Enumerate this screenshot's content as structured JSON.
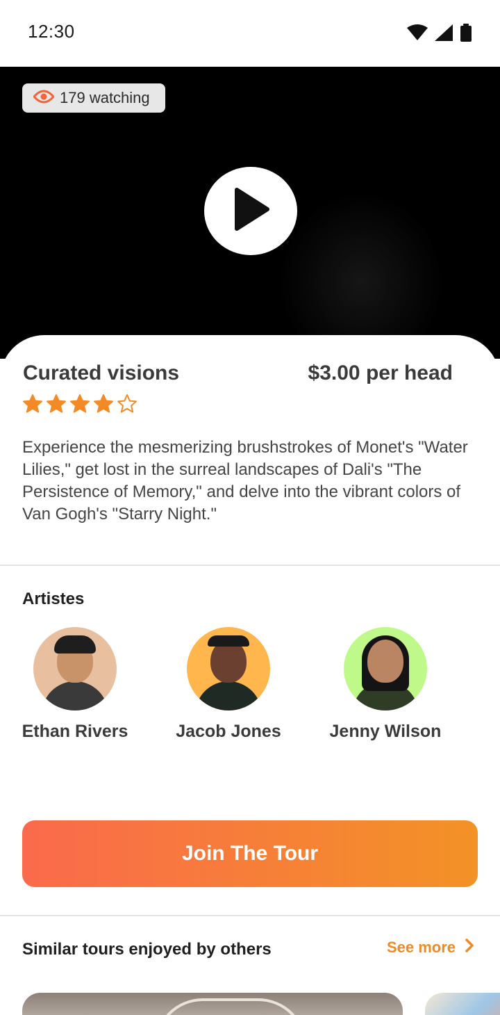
{
  "status_bar": {
    "time": "12:30",
    "icons": [
      "wifi-icon",
      "signal-icon",
      "battery-icon"
    ]
  },
  "video": {
    "watching_count": "179 watching",
    "icons": [
      "eye-icon",
      "play-icon"
    ]
  },
  "tour": {
    "title": "Curated visions",
    "price": "$3.00 per head",
    "rating": 4,
    "rating_max": 5,
    "description": "Experience the mesmerizing brushstrokes of Monet's \"Water Lilies,\" get lost in the surreal landscapes of Dali's \"The Persistence of Memory,\" and delve into the vibrant colors of Van Gogh's \"Starry Night.\""
  },
  "artistes": {
    "title": "Artistes",
    "items": [
      {
        "name": "Ethan Rivers",
        "avatar_bg": "#e8c09f"
      },
      {
        "name": "Jacob Jones",
        "avatar_bg": "#ffb74d"
      },
      {
        "name": "Jenny Wilson",
        "avatar_bg": "#bff98a"
      }
    ]
  },
  "cta": {
    "label": "Join The Tour"
  },
  "similar": {
    "title": "Similar tours enjoyed by others",
    "see_more": "See more"
  },
  "colors": {
    "accent": "#f08a24",
    "cta_gradient_start": "#fa6a4c",
    "cta_gradient_end": "#f39226",
    "star": "#f48a26",
    "eye": "#f4643c"
  }
}
